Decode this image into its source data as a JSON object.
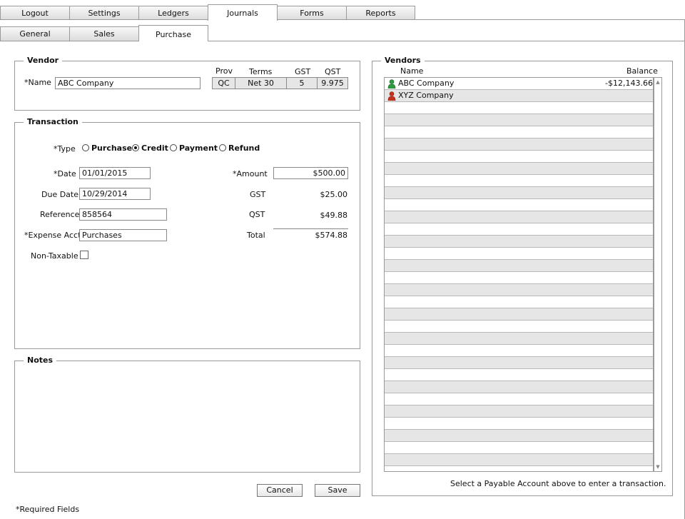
{
  "tabs": [
    "Logout",
    "Settings",
    "Ledgers",
    "Journals",
    "Forms",
    "Reports"
  ],
  "active_tab": "Journals",
  "subtabs": [
    "General",
    "Sales",
    "Purchase"
  ],
  "active_subtab": "Purchase",
  "vendor": {
    "legend": "Vendor",
    "name_label": "*Name",
    "name_value": "ABC Company",
    "headers": {
      "prov": "Prov",
      "terms": "Terms",
      "gst": "GST",
      "qst": "QST"
    },
    "prov": "QC",
    "terms": "Net 30",
    "gst": "5",
    "qst": "9.975"
  },
  "transaction": {
    "legend": "Transaction",
    "type_label": "*Type",
    "types": [
      "Purchase",
      "Credit",
      "Payment",
      "Refund"
    ],
    "selected_type": "Credit",
    "date_label": "*Date",
    "date_value": "01/01/2015",
    "due_label": "Due Date",
    "due_value": "10/29/2014",
    "ref_label": "Reference",
    "ref_value": "858564",
    "expense_label": "*Expense Acct",
    "expense_value": "Purchases",
    "nontax_label": "Non-Taxable",
    "amount_label": "*Amount",
    "amount_value": "$500.00",
    "gst_label": "GST",
    "gst_value": "$25.00",
    "qst_label": "QST",
    "qst_value": "$49.88",
    "total_label": "Total",
    "total_value": "$574.88"
  },
  "notes": {
    "legend": "Notes"
  },
  "buttons": {
    "cancel": "Cancel",
    "save": "Save"
  },
  "required_note": "*Required Fields",
  "vendors": {
    "legend": "Vendors",
    "col_name": "Name",
    "col_balance": "Balance",
    "items": [
      {
        "name": "ABC Company",
        "balance": "-$12,143.66",
        "icon_color": "#2e9b3f"
      },
      {
        "name": "XYZ Company",
        "balance": "",
        "icon_color": "#c4321f"
      }
    ],
    "hint": "Select a Payable Account above to enter a transaction."
  }
}
